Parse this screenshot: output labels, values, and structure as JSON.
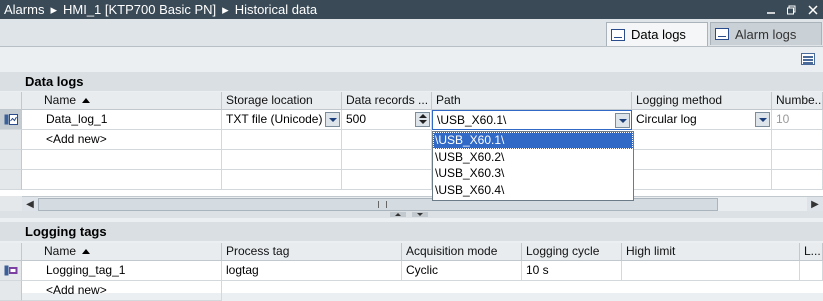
{
  "breadcrumb": [
    "Alarms",
    "HMI_1 [KTP700 Basic PN]",
    "Historical data"
  ],
  "tabs": [
    {
      "label": "Data logs",
      "active": true
    },
    {
      "label": "Alarm logs",
      "active": false
    }
  ],
  "data_logs": {
    "title": "Data logs",
    "columns": [
      "Name",
      "Storage location",
      "Data records ...",
      "Path",
      "Logging method",
      "Numbe..."
    ],
    "row": {
      "name": "Data_log_1",
      "storage": "TXT file (Unicode)",
      "records": "500",
      "path": "\\USB_X60.1\\",
      "method": "Circular log",
      "number": "10"
    },
    "add_new": "<Add new>",
    "path_options": [
      "\\USB_X60.1\\",
      "\\USB_X60.2\\",
      "\\USB_X60.3\\",
      "\\USB_X60.4\\"
    ],
    "selected_option": "\\USB_X60.1\\"
  },
  "logging_tags": {
    "title": "Logging tags",
    "columns": [
      "Name",
      "Process tag",
      "Acquisition mode",
      "Logging cycle",
      "High limit",
      "L..."
    ],
    "row": {
      "name": "Logging_tag_1",
      "process_tag": "logtag",
      "mode": "Cyclic",
      "cycle": "10 s",
      "high": "",
      "low": ""
    },
    "add_new": "<Add new>"
  },
  "colors": {
    "titlebar": "#3a4a57",
    "selection": "#3169c6",
    "grid_bg": "#ffffff"
  }
}
